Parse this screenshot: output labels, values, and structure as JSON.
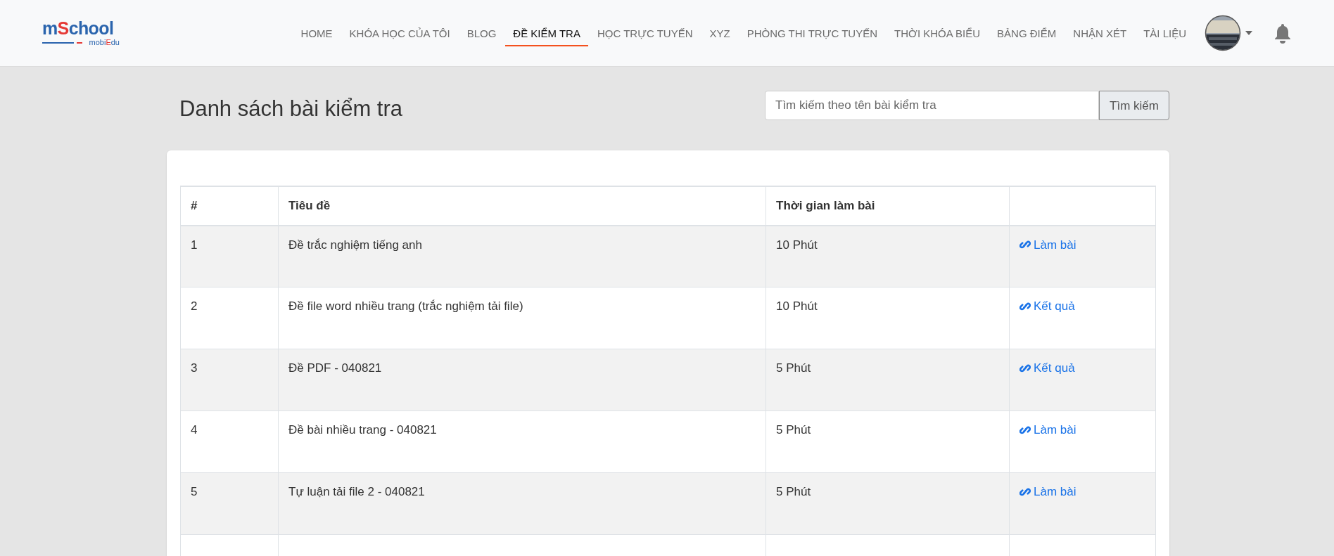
{
  "logo": {
    "main_prefix": "m",
    "main_accent": "S",
    "main_rest": "chool",
    "sub_prefix": "mobi",
    "sub_accent": "E",
    "sub_rest": "du"
  },
  "nav": [
    {
      "label": "HOME",
      "selected": false
    },
    {
      "label": "KHÓA HỌC CỦA TÔI",
      "selected": false
    },
    {
      "label": "BLOG",
      "selected": false
    },
    {
      "label": "ĐỀ KIỂM TRA",
      "selected": true
    },
    {
      "label": "HỌC TRỰC TUYẾN",
      "selected": false
    },
    {
      "label": "XYZ",
      "selected": false
    },
    {
      "label": "PHÒNG THI TRỰC TUYẾN",
      "selected": false
    },
    {
      "label": "THỜI KHÓA BIỂU",
      "selected": false
    },
    {
      "label": "BẢNG ĐIỂM",
      "selected": false
    },
    {
      "label": "NHẬN XÉT",
      "selected": false
    },
    {
      "label": "TÀI LIỆU",
      "selected": false
    }
  ],
  "page_title": "Danh sách bài kiểm tra",
  "search": {
    "placeholder": "Tìm kiếm theo tên bài kiểm tra",
    "button": "Tìm kiếm"
  },
  "table": {
    "columns": [
      "#",
      "Tiêu đề",
      "Thời gian làm bài"
    ],
    "rows": [
      {
        "index": "1",
        "title": "Đề trắc nghiệm tiếng anh",
        "duration": "10 Phút",
        "action": "Làm bài"
      },
      {
        "index": "2",
        "title": "Đề file word nhiều trang (trắc nghiệm tải file)",
        "duration": "10 Phút",
        "action": "Kết quả"
      },
      {
        "index": "3",
        "title": "Đề PDF - 040821",
        "duration": "5 Phút",
        "action": "Kết quả"
      },
      {
        "index": "4",
        "title": "Đề bài nhiều trang - 040821",
        "duration": "5 Phút",
        "action": "Làm bài"
      },
      {
        "index": "5",
        "title": "Tự luận tải file 2 - 040821",
        "duration": "5 Phút",
        "action": "Làm bài"
      }
    ]
  }
}
